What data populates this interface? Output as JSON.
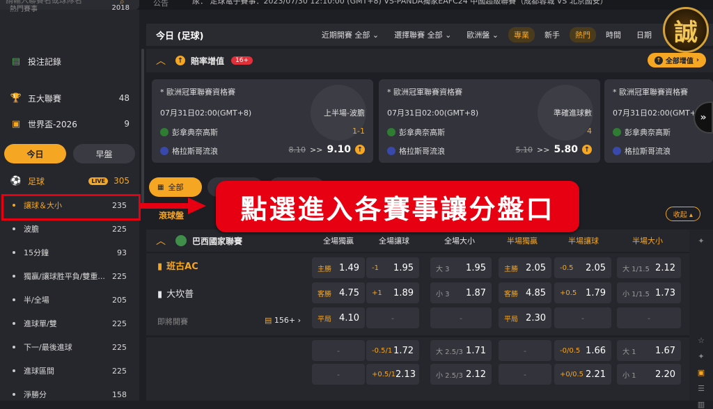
{
  "topbar": {
    "search_placeholder": "請輸入聯賽名或球隊名",
    "notice_label": "公告",
    "marquee": "尿：     足球電子賽事：2023/07/30 12:10:00 (GMT+8) VS-PANDA獨家EAFC24 中國超級聯賽（成都蓉城 VS 北京國安）"
  },
  "sidebar": {
    "partial_item": "熱門賽事",
    "partial_count": "2018",
    "bet_record": "投注記錄",
    "items": [
      {
        "label": "五大聯賽",
        "count": "48",
        "icon": "trophy-icon"
      },
      {
        "label": "世界盃-2026",
        "count": "9",
        "icon": "cup-icon"
      }
    ],
    "tab_today": "今日",
    "tab_early": "早盤",
    "sport": {
      "label": "足球",
      "live": "LIVE",
      "count": "305"
    },
    "subs": [
      {
        "label": "讓球＆大小",
        "count": "235"
      },
      {
        "label": "波膽",
        "count": "225"
      },
      {
        "label": "15分鐘",
        "count": "93"
      },
      {
        "label": "獨贏/讓球胜平負/雙重...",
        "count": "225"
      },
      {
        "label": "半/全場",
        "count": "205"
      },
      {
        "label": "進球單/雙",
        "count": "225"
      },
      {
        "label": "下一/最後進球",
        "count": "225"
      },
      {
        "label": "進球區間",
        "count": "225"
      },
      {
        "label": "淨勝分",
        "count": "158"
      }
    ]
  },
  "main": {
    "title": "今日 (足球)",
    "filters": {
      "recent_label": "近期開賽",
      "recent_value": "全部",
      "league_label": "選擇聯賽",
      "league_value": "全部",
      "odds_type": "歐洲盤",
      "pro": "專業",
      "novice": "新手",
      "hot": "熱門",
      "time": "時間",
      "date": "日期"
    }
  },
  "boost": {
    "title": "賠率增值",
    "badge": "16+",
    "all_label": "全部增值",
    "cards": [
      {
        "league": "* 歐洲冠軍聯賽資格賽",
        "time": "07月31日02:00(GMT+8)",
        "market": "上半場-波膽",
        "home": "彭拿典奈高斯",
        "away": "格拉斯哥流浪",
        "score": "1-1",
        "old": "8.10",
        "arrow": ">>",
        "new": "9.10"
      },
      {
        "league": "* 歐洲冠軍聯賽資格賽",
        "time": "07月31日02:00(GMT+8)",
        "market": "準確進球數",
        "home": "彭拿典奈高斯",
        "away": "格拉斯哥流浪",
        "score": "4",
        "old": "5.10",
        "arrow": ">>",
        "new": "5.80"
      },
      {
        "league": "* 歐洲冠軍聯賽資格賽",
        "time": "07月31日02:00(GMT+8)",
        "market": "",
        "home": "彭拿典奈高斯",
        "away": "格拉斯哥流浪",
        "score": "",
        "old": "",
        "arrow": "",
        "new": ""
      }
    ],
    "next": "»"
  },
  "chips": {
    "all": "全部"
  },
  "banner": "點選進入各賽事讓分盤口",
  "live": {
    "title": "滾球盤",
    "collapse": "收起"
  },
  "league": {
    "name": "巴西國家聯賽",
    "cols": [
      "全場獨贏",
      "全場讓球",
      "全場大小",
      "半場獨贏",
      "半場讓球",
      "半場大小"
    ]
  },
  "match1": {
    "home": "班古AC",
    "away": "大坎普",
    "status": "即將開賽",
    "more": "156+",
    "rows": [
      [
        {
          "l": "主勝",
          "v": "1.49"
        },
        {
          "l": "-1",
          "v": "1.95"
        },
        {
          "l": "大 3",
          "v": "1.95"
        },
        {
          "l": "主勝",
          "v": "2.05"
        },
        {
          "l": "-0.5",
          "v": "2.05"
        },
        {
          "l": "大 1/1.5",
          "v": "2.12"
        }
      ],
      [
        {
          "l": "客勝",
          "v": "4.75"
        },
        {
          "l": "+1",
          "v": "1.89"
        },
        {
          "l": "小 3",
          "v": "1.87"
        },
        {
          "l": "客勝",
          "v": "4.85"
        },
        {
          "l": "+0.5",
          "v": "1.79"
        },
        {
          "l": "小 1/1.5",
          "v": "1.73"
        }
      ],
      [
        {
          "l": "平局",
          "v": "4.10"
        },
        {
          "l": "",
          "v": "-"
        },
        {
          "l": "",
          "v": "-"
        },
        {
          "l": "平局",
          "v": "2.30"
        },
        {
          "l": "",
          "v": "-"
        },
        {
          "l": "",
          "v": "-"
        }
      ]
    ]
  },
  "match2": {
    "rows": [
      [
        {
          "l": "",
          "v": "-"
        },
        {
          "l": "-0.5/1",
          "v": "1.72"
        },
        {
          "l": "大 2.5/3",
          "v": "1.71"
        },
        {
          "l": "",
          "v": "-"
        },
        {
          "l": "-0/0.5",
          "v": "1.66"
        },
        {
          "l": "大 1",
          "v": "1.67"
        }
      ],
      [
        {
          "l": "",
          "v": "-"
        },
        {
          "l": "+0.5/1",
          "v": "2.13"
        },
        {
          "l": "小 2.5/3",
          "v": "2.12"
        },
        {
          "l": "",
          "v": "-"
        },
        {
          "l": "+0/0.5",
          "v": "2.21"
        },
        {
          "l": "小 1",
          "v": "2.20"
        }
      ]
    ]
  },
  "logo_char": "誠",
  "colors": {
    "accent": "#f5a623",
    "highlight": "#e60012",
    "bg": "#1e1f24"
  }
}
